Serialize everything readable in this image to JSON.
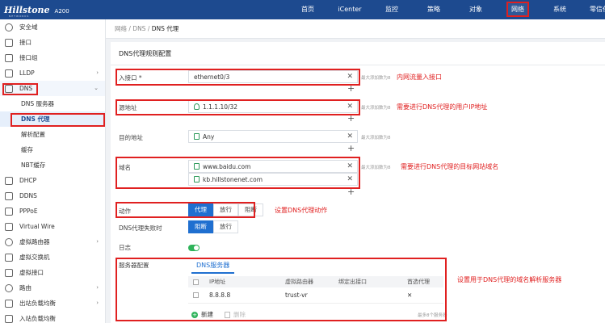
{
  "header": {
    "logo": "Hillstone",
    "logo_sub": "NETWORKS",
    "model": "A200",
    "nav": [
      "首页",
      "iCenter",
      "监控",
      "策略",
      "对象",
      "网络",
      "系统",
      "零信任访问"
    ],
    "active_nav": "网络"
  },
  "sidebar": {
    "items": [
      {
        "label": "安全域",
        "icon": "globe-icon"
      },
      {
        "label": "接口",
        "icon": "interface-icon"
      },
      {
        "label": "接口组",
        "icon": "interface-group-icon"
      },
      {
        "label": "LLDP",
        "icon": "lldp-icon",
        "chevron": "›"
      },
      {
        "label": "DNS",
        "icon": "dns-icon",
        "chevron": "⌄"
      },
      {
        "label": "DNS 服务器",
        "sub": true
      },
      {
        "label": "DNS 代理",
        "sub": true,
        "active": true
      },
      {
        "label": "解析配置",
        "sub": true
      },
      {
        "label": "缓存",
        "sub": true
      },
      {
        "label": "NBT缓存",
        "sub": true
      },
      {
        "label": "DHCP",
        "icon": "dhcp-icon"
      },
      {
        "label": "DDNS",
        "icon": "ddns-icon"
      },
      {
        "label": "PPPoE",
        "icon": "pppoe-icon"
      },
      {
        "label": "Virtual Wire",
        "icon": "virtual-wire-icon"
      },
      {
        "label": "虚拟路由器",
        "icon": "virtual-router-icon",
        "chevron": "›"
      },
      {
        "label": "虚拟交换机",
        "icon": "virtual-switch-icon"
      },
      {
        "label": "虚拟接口",
        "icon": "virtual-interface-icon"
      },
      {
        "label": "路由",
        "icon": "route-icon",
        "chevron": "›"
      },
      {
        "label": "出站负载均衡",
        "icon": "outbound-lb-icon",
        "chevron": "›"
      },
      {
        "label": "入站负载均衡",
        "icon": "inbound-lb-icon"
      }
    ]
  },
  "breadcrumb": {
    "path": "网络 / DNS / ",
    "current": "DNS 代理"
  },
  "form": {
    "section_title": "DNS代理规则配置",
    "ingress_label": "入接口 *",
    "ingress_value": "ethernet0/3",
    "ingress_hint": "最大添加数为8",
    "ingress_note": "内网流量入接口",
    "source_label": "源地址",
    "source_value": "1.1.1.10/32",
    "source_hint": "最大添加数为8",
    "source_note": "需要进行DNS代理的用户IP地址",
    "dest_label": "目的地址",
    "dest_value": "Any",
    "dest_hint": "最大添加数为8",
    "domain_label": "域名",
    "domain_values": [
      "www.baidu.com",
      "kb.hillstonenet.com"
    ],
    "domain_hint": "最大添加数为8",
    "domain_note": "需要进行DNS代理的目标网站域名",
    "action_label": "动作",
    "action_options": [
      "代理",
      "放行",
      "阻断"
    ],
    "action_note": "设置DNS代理动作",
    "fail_label": "DNS代理失败时",
    "fail_options": [
      "阻断",
      "放行"
    ],
    "log_label": "日志",
    "log_enabled": true,
    "server_label": "服务器配置",
    "server_tab": "DNS服务器",
    "server_note": "设置用于DNS代理的域名解析服务器",
    "table_headers": [
      "IP地址",
      "虚拟路由器",
      "绑定出接口",
      "首选代理"
    ],
    "table_rows": [
      {
        "ip": "8.8.8.8",
        "vr": "trust-vr",
        "iface": "",
        "preferred": "✕"
      }
    ],
    "add_label": "新建",
    "delete_label": "删除",
    "max_hint": "最多8个服务器",
    "clear_icon": "✕",
    "plus_icon": "+"
  }
}
